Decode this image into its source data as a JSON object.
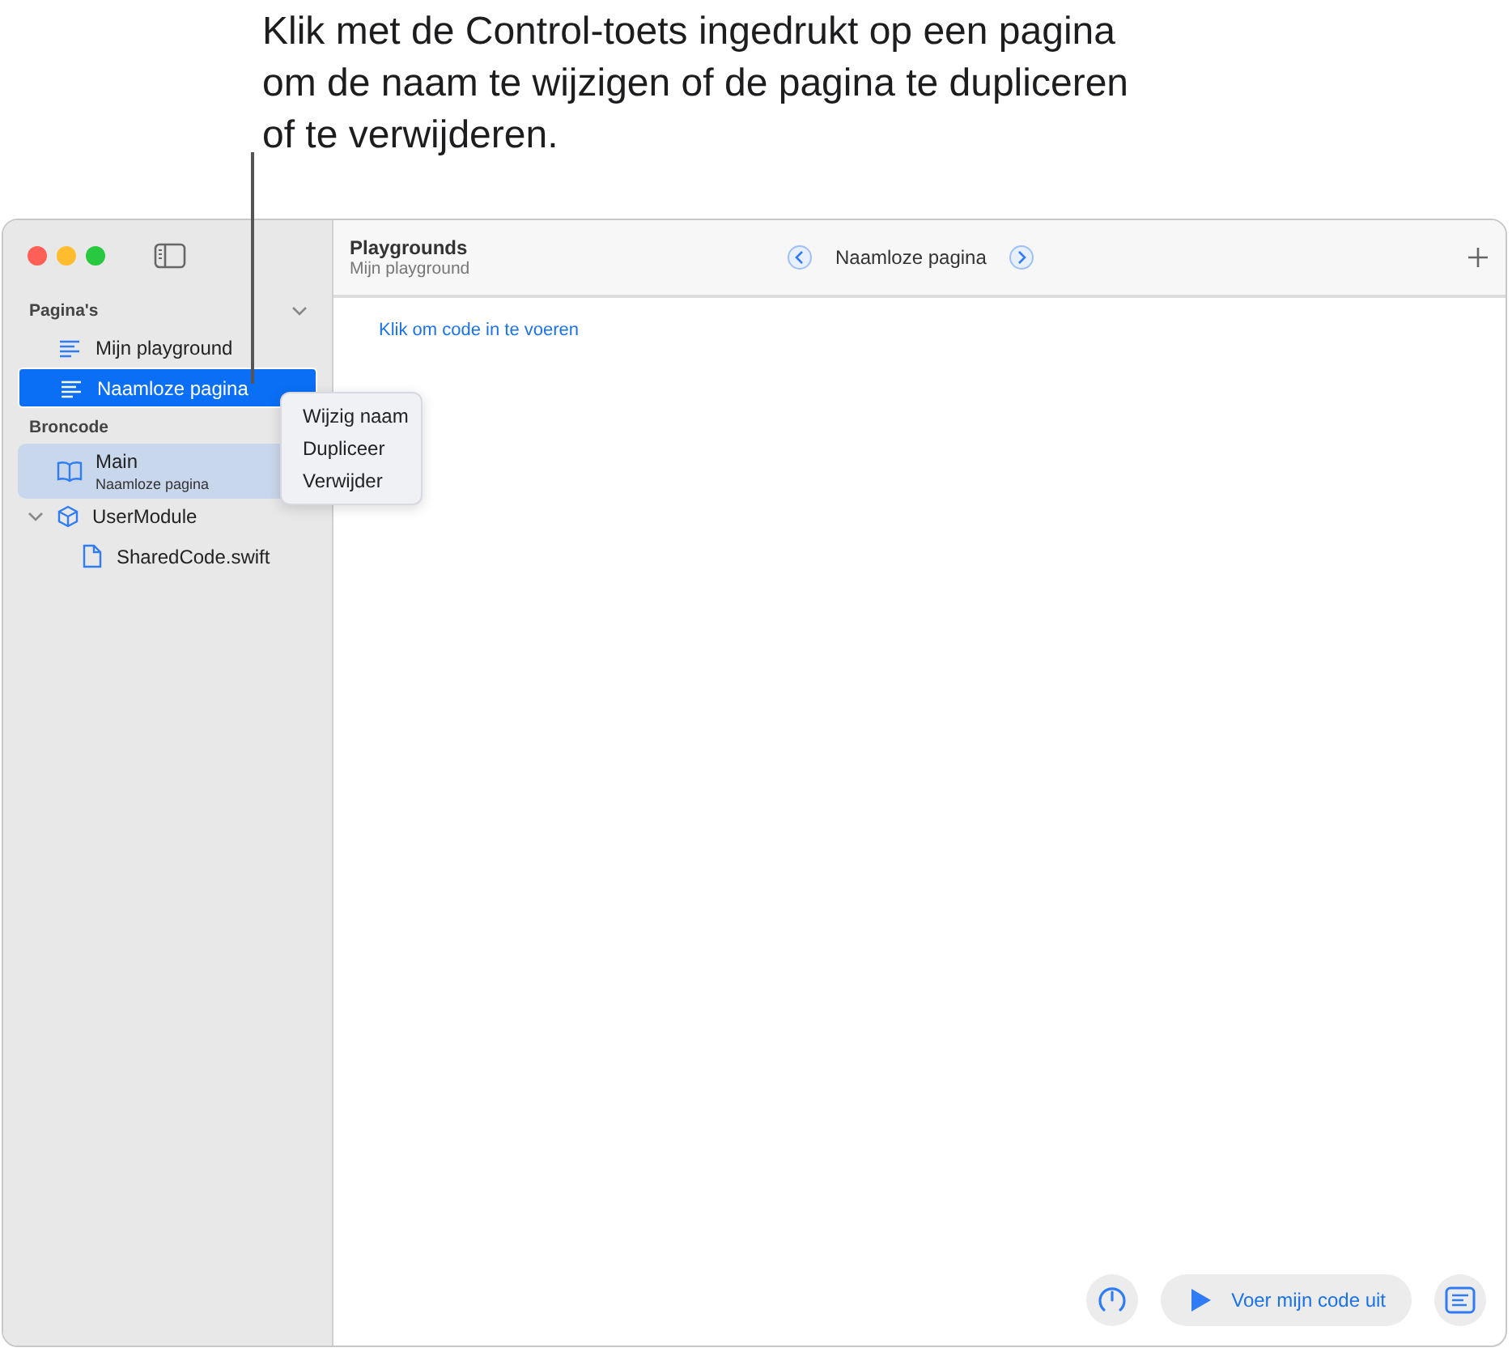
{
  "callout": "Klik met de Control-toets ingedrukt op een pagina om de naam te wijzigen of de pagina te dupliceren of te verwijderen.",
  "sidebar": {
    "sections": [
      {
        "title": "Pagina's",
        "expanded": true,
        "kind": "pages",
        "items": [
          {
            "label": "Mijn playground",
            "selected": false
          },
          {
            "label": "Naamloze pagina",
            "selected": true
          }
        ]
      },
      {
        "title": "Broncode",
        "kind": "sources",
        "items": [
          {
            "label": "Main",
            "subtitle": "Naamloze pagina",
            "kind": "book",
            "selected": true
          },
          {
            "label": "UserModule",
            "kind": "module",
            "expanded": true,
            "selected": false,
            "children": [
              {
                "label": "SharedCode.swift",
                "kind": "file",
                "selected": false
              }
            ]
          }
        ]
      }
    ]
  },
  "context_menu": [
    "Wijzig naam",
    "Dupliceer",
    "Verwijder"
  ],
  "toolbar": {
    "title": "Playgrounds",
    "subtitle": "Mijn playground",
    "page": "Naamloze pagina"
  },
  "editor": {
    "placeholder": "Klik om code in te voeren"
  },
  "run_button": "Voer mijn code uit"
}
